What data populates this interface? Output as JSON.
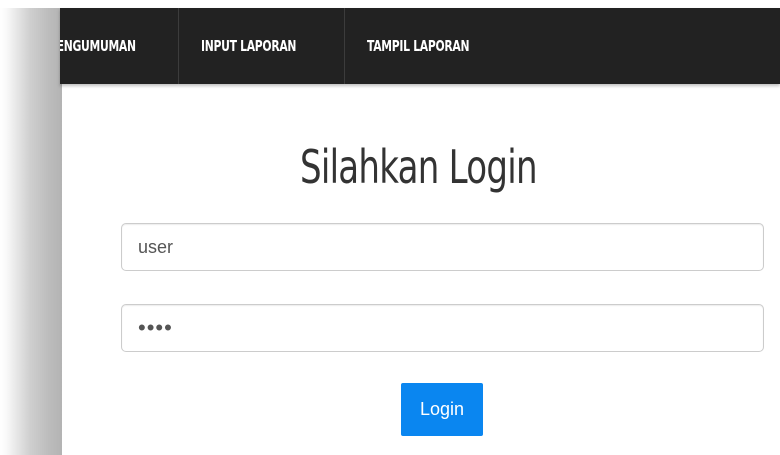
{
  "navbar": {
    "items": [
      {
        "label": "PENGUMUMAN"
      },
      {
        "label": "INPUT LAPORAN"
      },
      {
        "label": "TAMPIL LAPORAN"
      }
    ]
  },
  "login": {
    "title": "Silahkan Login",
    "username_value": "user",
    "password_value": "pass",
    "button_label": "Login"
  },
  "colors": {
    "navbar_bg": "#222222",
    "button_bg": "#0a86f0",
    "title_text": "#333333"
  }
}
